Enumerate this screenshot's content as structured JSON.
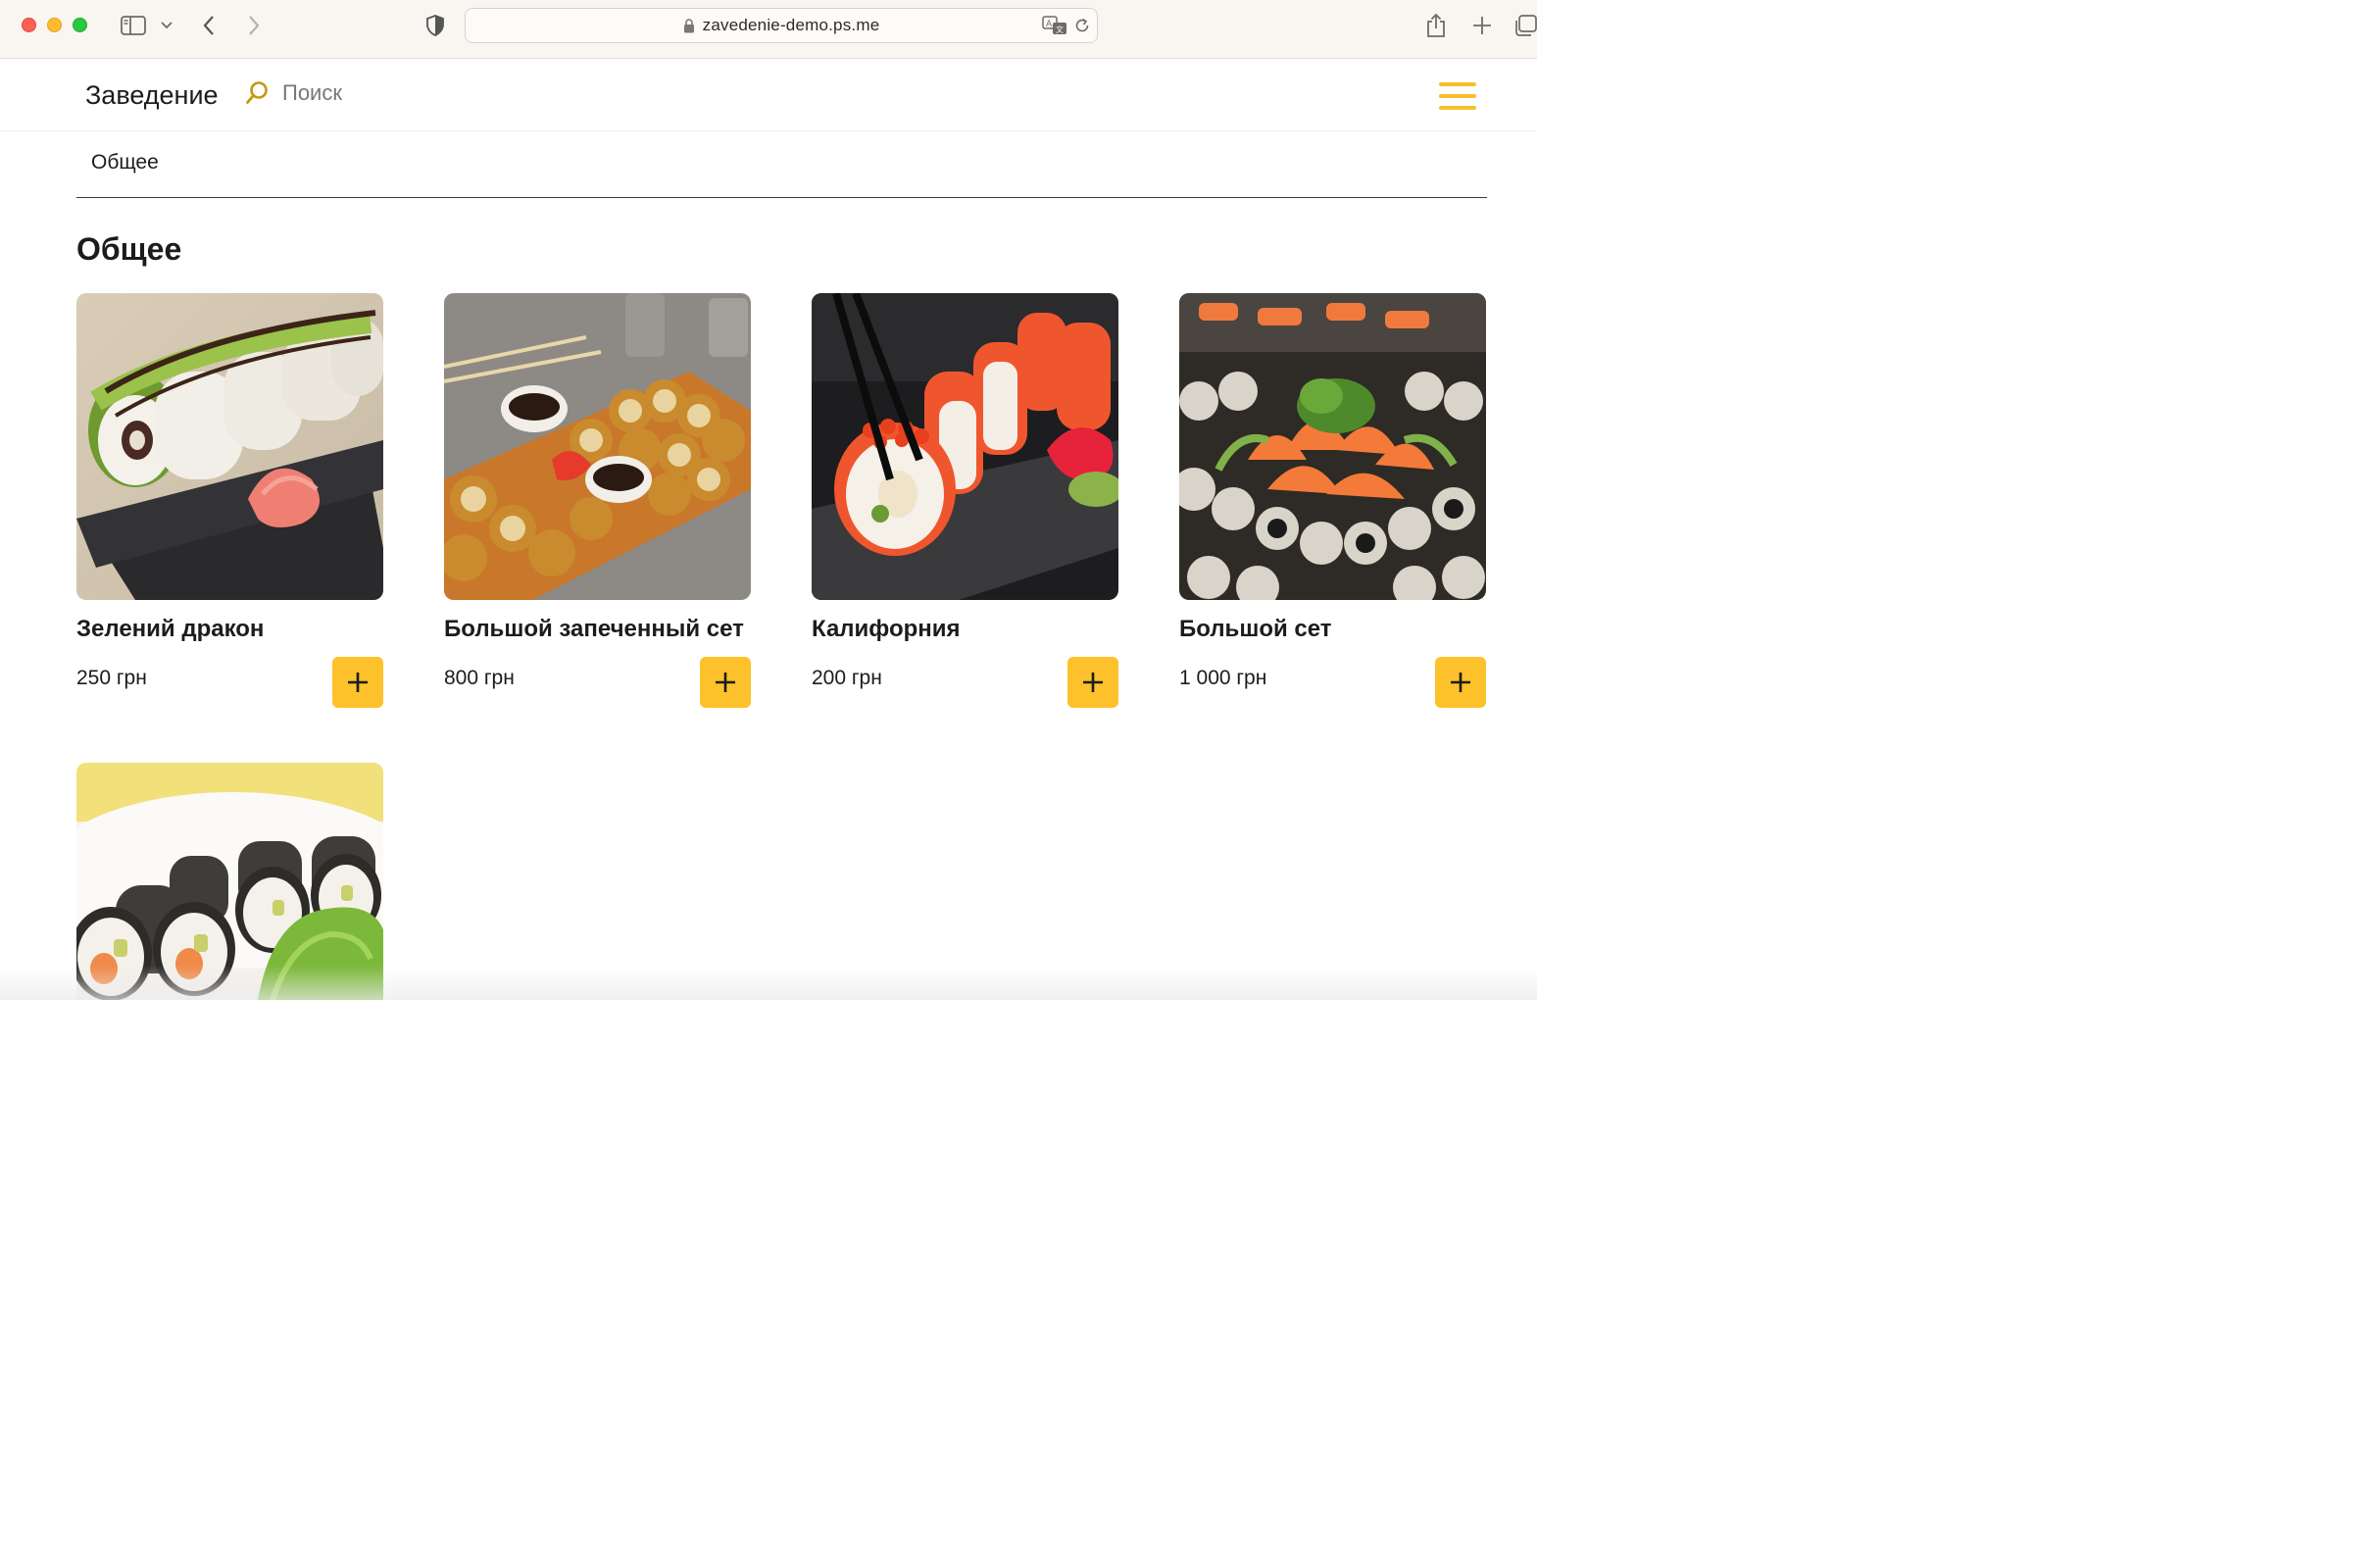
{
  "browser": {
    "url": "zavedenie-demo.ps.me"
  },
  "header": {
    "brand": "Заведение",
    "search_placeholder": "Поиск"
  },
  "tabs": [
    {
      "label": "Общее"
    }
  ],
  "section": {
    "title": "Общее"
  },
  "products": [
    {
      "name": "Зелений дракон",
      "price": "250 грн"
    },
    {
      "name": "Большой запеченный сет",
      "price": "800 грн"
    },
    {
      "name": "Калифорния",
      "price": "200 грн"
    },
    {
      "name": "Большой сет",
      "price": "1 000 грн"
    },
    {
      "name": "",
      "price": ""
    }
  ],
  "colors": {
    "accent": "#fdc12b",
    "text": "#1c1c1c",
    "chrome_bg": "#f9f5f1"
  }
}
